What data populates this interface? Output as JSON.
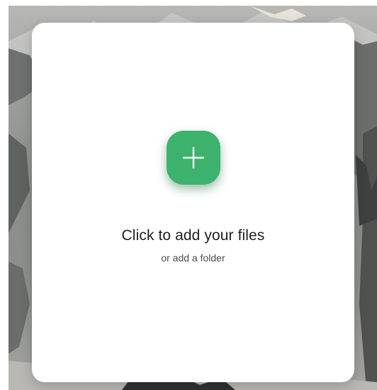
{
  "upload": {
    "title": "Click to add your files",
    "folder_link": "or add a folder",
    "button_icon": "plus-icon",
    "accent_color": "#3db26d"
  },
  "background": {
    "description_color_top": "#b7b8b6",
    "description_color_bottom": "#a4a5a2"
  }
}
